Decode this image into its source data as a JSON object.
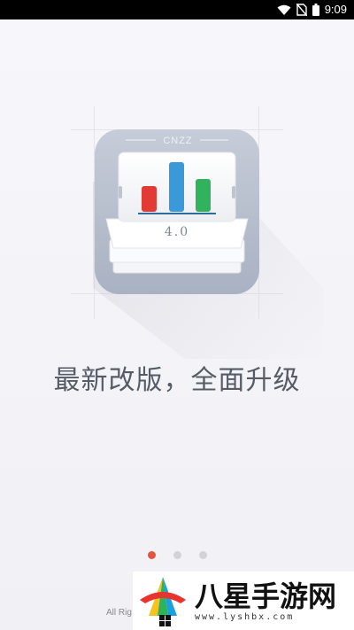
{
  "status_bar": {
    "time": "9:09",
    "icons": [
      "wifi-icon",
      "no-sim-icon",
      "battery-icon"
    ]
  },
  "splash": {
    "logo": {
      "brand": "CNZZ",
      "version": "4.0"
    },
    "headline": "最新改版，全面升级",
    "pager": {
      "count": 3,
      "active_index": 0,
      "active_color": "#e4553d",
      "inactive_color": "#d2d2d8"
    },
    "copyright": "All Rig"
  },
  "watermark": {
    "text": "八星手游网",
    "url": "www.lyshbx.com"
  },
  "colors": {
    "bar_red": "#e23b35",
    "bar_blue": "#3a9ad9",
    "bar_green": "#31b35d",
    "logo_frame": "#b9c1cf"
  }
}
